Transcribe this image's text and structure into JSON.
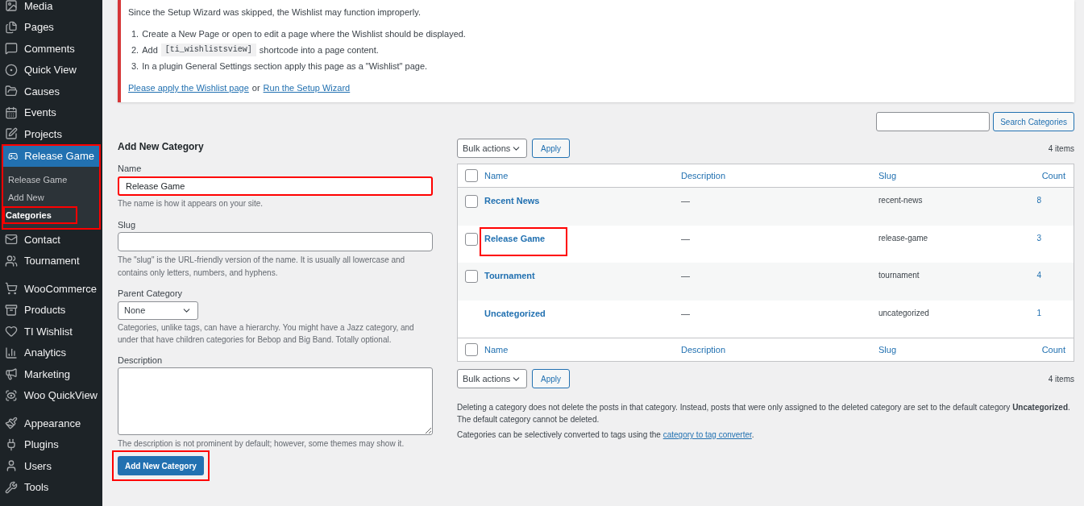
{
  "sidebar": {
    "items": [
      {
        "label": "Media",
        "selected": false,
        "highlighted": false,
        "separator_before": false
      },
      {
        "label": "Pages",
        "selected": false,
        "highlighted": false,
        "separator_before": false
      },
      {
        "label": "Comments",
        "selected": false,
        "highlighted": false,
        "separator_before": false
      },
      {
        "label": "Quick View",
        "selected": false,
        "highlighted": false,
        "separator_before": false
      },
      {
        "label": "Causes",
        "selected": false,
        "highlighted": false,
        "separator_before": false
      },
      {
        "label": "Events",
        "selected": false,
        "highlighted": false,
        "separator_before": false
      },
      {
        "label": "Projects",
        "selected": false,
        "highlighted": false,
        "separator_before": false
      },
      {
        "label": "Release Game",
        "selected": true,
        "highlighted": true,
        "separator_before": false,
        "children": [
          {
            "label": "Release Game",
            "selected": false,
            "highlighted": false
          },
          {
            "label": "Add New",
            "selected": false,
            "highlighted": false
          },
          {
            "label": "Categories",
            "selected": true,
            "highlighted": true
          }
        ]
      },
      {
        "label": "Contact",
        "selected": false,
        "highlighted": false,
        "separator_before": false
      },
      {
        "label": "Tournament",
        "selected": false,
        "highlighted": false,
        "separator_before": false
      },
      {
        "label": "WooCommerce",
        "selected": false,
        "highlighted": false,
        "separator_before": true
      },
      {
        "label": "Products",
        "selected": false,
        "highlighted": false,
        "separator_before": false
      },
      {
        "label": "TI Wishlist",
        "selected": false,
        "highlighted": false,
        "separator_before": false
      },
      {
        "label": "Analytics",
        "selected": false,
        "highlighted": false,
        "separator_before": false
      },
      {
        "label": "Marketing",
        "selected": false,
        "highlighted": false,
        "separator_before": false
      },
      {
        "label": "Woo QuickView",
        "selected": false,
        "highlighted": false,
        "separator_before": false
      },
      {
        "label": "Appearance",
        "selected": false,
        "highlighted": false,
        "separator_before": true
      },
      {
        "label": "Plugins",
        "selected": false,
        "highlighted": false,
        "separator_before": false
      },
      {
        "label": "Users",
        "selected": false,
        "highlighted": false,
        "separator_before": false
      },
      {
        "label": "Tools",
        "selected": false,
        "highlighted": false,
        "separator_before": false
      }
    ]
  },
  "notice": {
    "text": "Since the Setup Wizard was skipped, the Wishlist may function improperly.",
    "steps": [
      {
        "number": "1.",
        "text": "Create a New Page or open to edit a page where the Wishlist should be displayed."
      },
      {
        "number": "2.",
        "text": "Add",
        "code": "[ti_wishlistsview]",
        "after": "shortcode into a page content."
      },
      {
        "number": "3.",
        "text": "In a plugin General Settings section apply this page as a \"Wishlist\" page."
      }
    ],
    "link_1": "Please apply the Wishlist page",
    "joiner": "or",
    "link_2": "Run the Setup Wizard"
  },
  "form": {
    "title": "Add New Category",
    "name": {
      "label": "Name",
      "value": "Release Game",
      "hint": "The name is how it appears on your site.",
      "highlighted": true
    },
    "slug": {
      "label": "Slug",
      "hint": "The \"slug\" is the URL-friendly version of the name. It is usually all lowercase and contains only letters, numbers, and hyphens."
    },
    "parent": {
      "label": "Parent Category",
      "value": "None",
      "hint": "Categories, unlike tags, can have a hierarchy. You might have a Jazz category, and under that have children categories for Bebop and Big Band. Totally optional."
    },
    "description": {
      "label": "Description",
      "hint": "The description is not prominent by default; however, some themes may show it."
    },
    "submit": {
      "label": "Add New Category",
      "highlighted": true
    }
  },
  "search": {
    "button": "Search Categories"
  },
  "table": {
    "top_nav": {
      "bulk_actions": "Bulk actions",
      "apply": "Apply",
      "items_count": "4 items"
    },
    "header": {
      "checked": false,
      "columns": [
        "Name",
        "Description",
        "Slug",
        "Count"
      ]
    },
    "rows": [
      {
        "name": "Recent News",
        "description": "—",
        "slug": "recent-news",
        "count": "8",
        "has_checkbox": true,
        "checked": false,
        "highlighted": false
      },
      {
        "name": "Release Game",
        "description": "—",
        "slug": "release-game",
        "count": "3",
        "has_checkbox": true,
        "checked": false,
        "highlighted": true
      },
      {
        "name": "Tournament",
        "description": "—",
        "slug": "tournament",
        "count": "4",
        "has_checkbox": true,
        "checked": false,
        "highlighted": false
      },
      {
        "name": "Uncategorized",
        "description": "—",
        "slug": "uncategorized",
        "count": "1",
        "has_checkbox": false,
        "highlighted": false
      }
    ],
    "footer": {
      "checked": false,
      "columns": [
        "Name",
        "Description",
        "Slug",
        "Count"
      ]
    },
    "bottom_nav": {
      "bulk_actions": "Bulk actions",
      "apply": "Apply",
      "items_count": "4 items"
    }
  },
  "notes": {
    "delete_note": "Deleting a category does not delete the posts in that category. Instead, posts that were only assigned to the deleted category are set to the default category **Uncategorized**. The default category cannot be deleted.",
    "convert_before": "Categories can be selectively converted to tags using the",
    "convert_link": "category to tag converter",
    "convert_after": "."
  }
}
